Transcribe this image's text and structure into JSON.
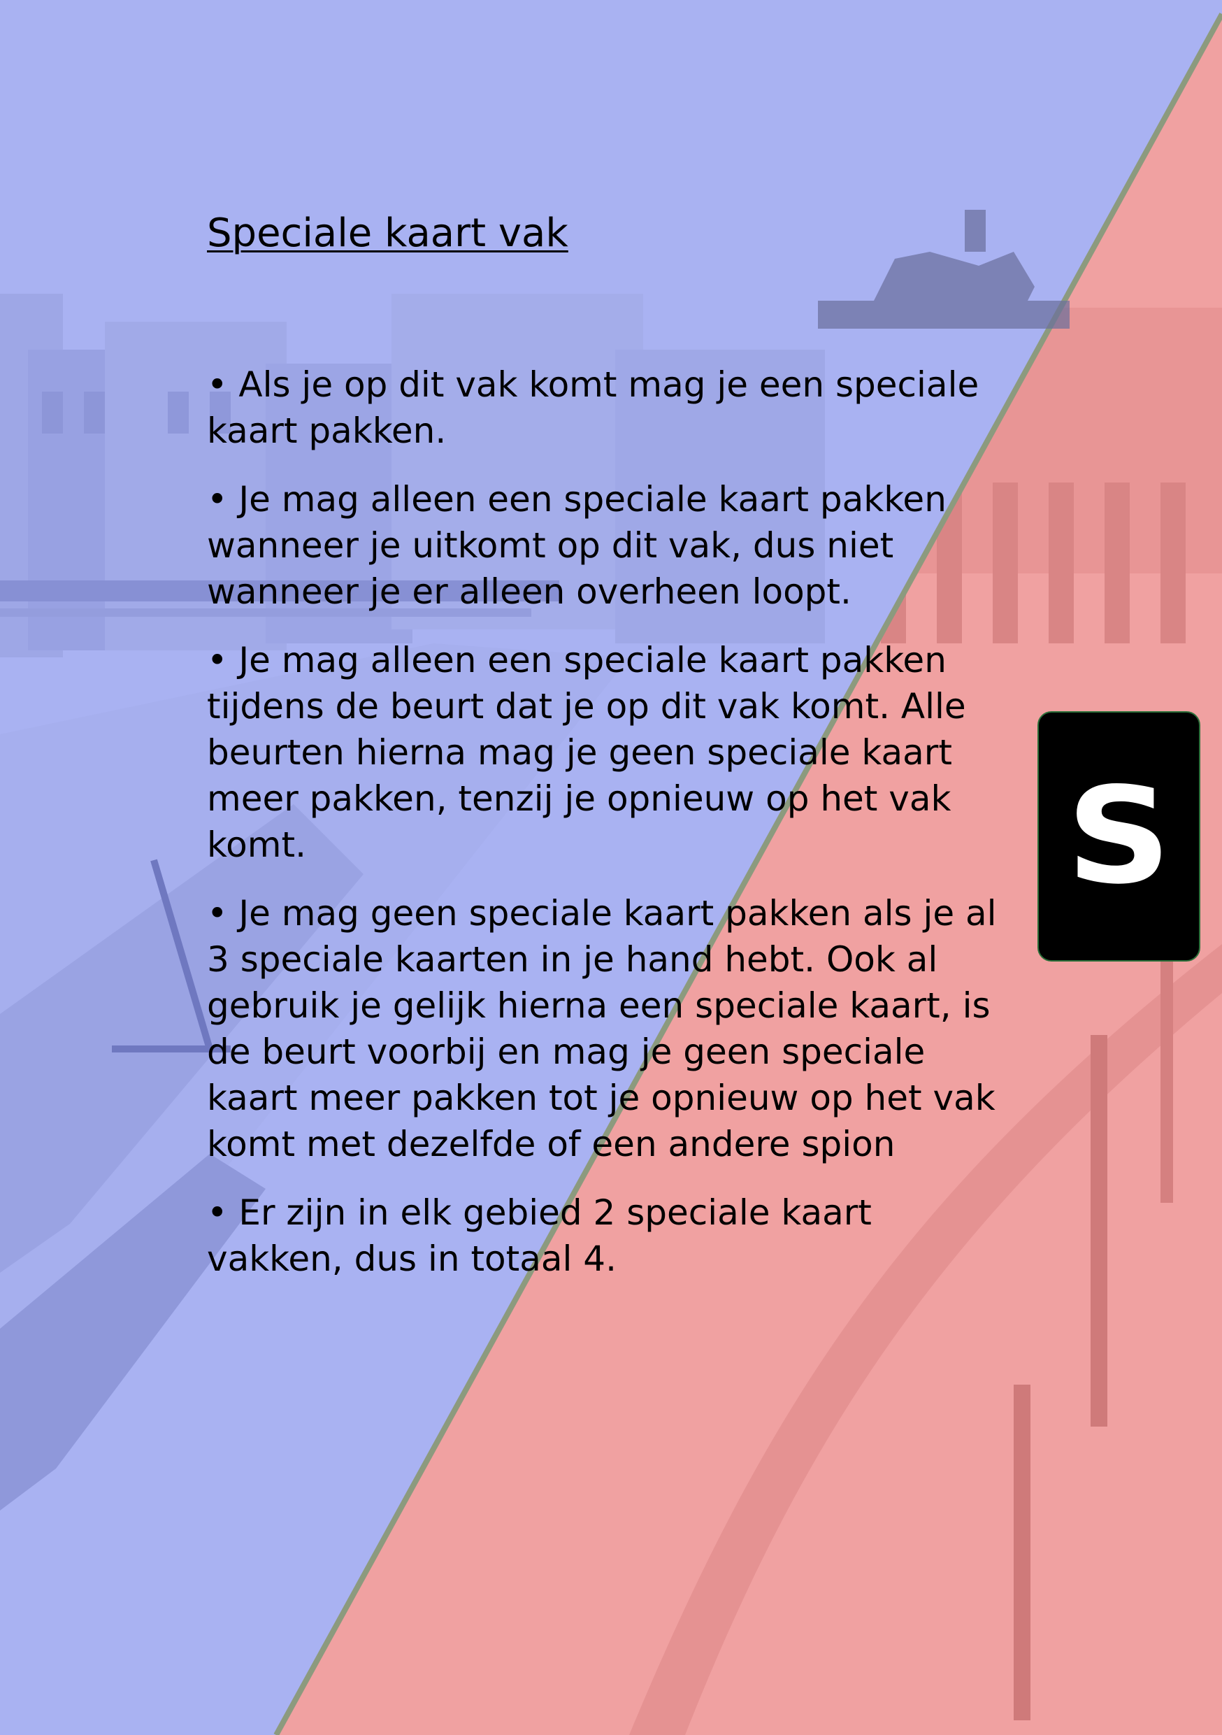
{
  "document": {
    "title": "Speciale kaart vak",
    "rules": [
      "• Als je op dit vak komt mag je een speciale kaart pakken.",
      "• Je mag alleen een speciale kaart pakken wanneer je uitkomt op dit vak, dus niet wanneer je er alleen overheen loopt.",
      "• Je mag alleen een speciale kaart pakken tijdens de beurt dat je op dit vak komt. Alle beurten hierna mag je geen speciale kaart meer pakken, tenzij je opnieuw op het vak komt.",
      "• Je mag geen speciale kaart pakken als je al 3 speciale kaarten in je hand hebt. Ook al gebruik je gelijk hierna een speciale kaart, is de beurt voorbij en mag je geen speciale kaart meer pakken tot je opnieuw op het vak komt met dezelfde of een andere spion",
      "• Er zijn in elk gebied 2 speciale kaart vakken, dus in totaal 4."
    ]
  },
  "card": {
    "letter": "S"
  },
  "colors": {
    "blue_overlay": "#a7b0f0",
    "red_overlay": "#f0a0a0",
    "card_background": "#000000",
    "card_letter": "#ffffff"
  }
}
